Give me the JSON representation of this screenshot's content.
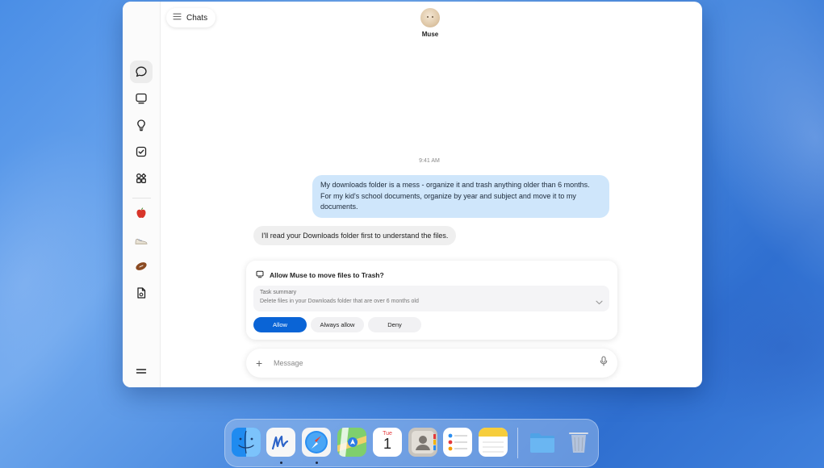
{
  "window": {
    "chats_button_label": "Chats",
    "agent_name": "Muse"
  },
  "sidebar": {
    "items": [
      {
        "icon": "chat-bubble-icon"
      },
      {
        "icon": "monitor-icon"
      },
      {
        "icon": "lightbulb-icon"
      },
      {
        "icon": "checkbox-icon"
      },
      {
        "icon": "apps-grid-icon"
      },
      {
        "icon": "apple-icon"
      },
      {
        "icon": "sneaker-icon"
      },
      {
        "icon": "football-icon"
      },
      {
        "icon": "document-icon"
      }
    ],
    "menu_icon": "hamburger-menu-icon"
  },
  "conversation": {
    "timestamp": "9:41 AM",
    "user_message": "My downloads folder is a mess - organize it and trash anything older than 6 months. For my kid's school documents, organize by year and subject and move it to my documents.",
    "agent_message": "I'll read your Downloads folder first to understand the files."
  },
  "permission": {
    "title": "Allow Muse to move files to Trash?",
    "summary_label": "Task summary",
    "summary_text": "Delete files in your Downloads folder that are over 6 months old",
    "allow_label": "Allow",
    "always_allow_label": "Always allow",
    "deny_label": "Deny",
    "accent_color": "#0a64d6"
  },
  "composer": {
    "placeholder": "Message"
  },
  "dock": {
    "apps": [
      "Finder",
      "Muse",
      "Safari",
      "Maps",
      "Calendar",
      "Contacts",
      "Reminders",
      "Notes",
      "Downloads",
      "Trash"
    ],
    "calendar_day": "Tue",
    "calendar_date": "1"
  }
}
